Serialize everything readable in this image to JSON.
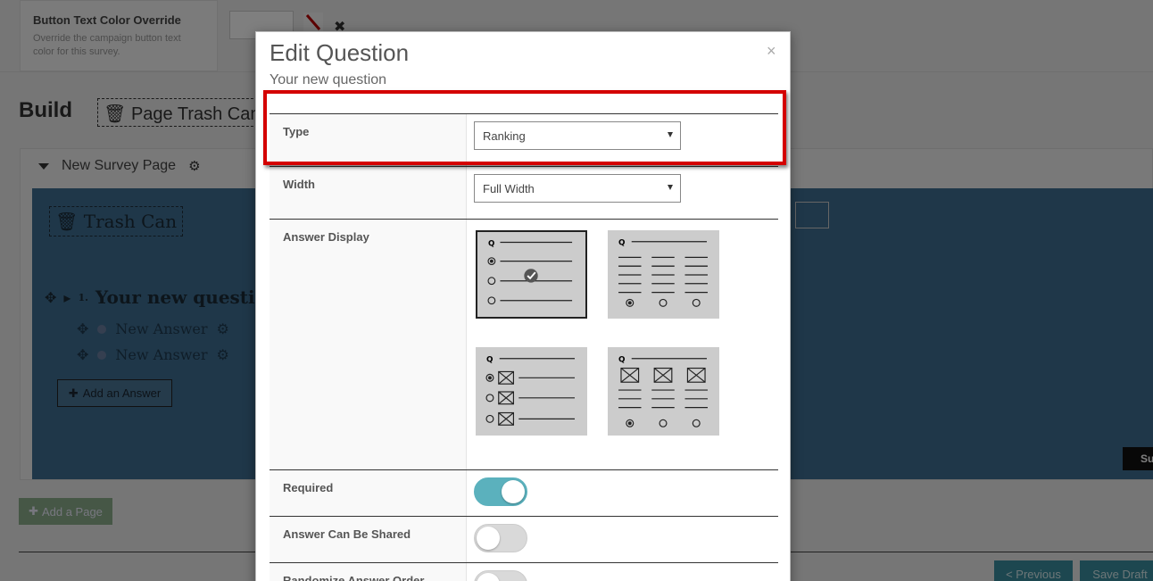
{
  "background": {
    "override": {
      "title": "Button Text Color Override",
      "description": "Override the campaign button text color for this survey."
    },
    "build_title": "Build",
    "page_trash_label": "Page Trash Can",
    "page_name": "New Survey Page",
    "trash_can_label": "Trash Can",
    "question": {
      "number": "1.",
      "text": "Your new question"
    },
    "answers": [
      "New Answer",
      "New Answer"
    ],
    "add_answer_label": "Add an Answer",
    "submit_partial": "Su",
    "add_page_label": "Add a Page",
    "previous_label": "< Previous",
    "save_draft_label": "Save Draft"
  },
  "modal": {
    "title": "Edit Question",
    "subtitle": "Your new question",
    "close_glyph": "×",
    "fields": {
      "type": {
        "label": "Type",
        "value": "Ranking"
      },
      "width": {
        "label": "Width",
        "value": "Full Width"
      },
      "answer_display": {
        "label": "Answer Display"
      },
      "required": {
        "label": "Required",
        "on": true
      },
      "shared": {
        "label": "Answer Can Be Shared",
        "on": false
      },
      "randomize": {
        "label": "Randomize Answer Order",
        "on": false
      }
    }
  },
  "colors": {
    "highlight": "#d40000",
    "toggle_on": "#5bb1bd",
    "toggle_off": "#d9d9d9",
    "page_area": "#3f6f93"
  }
}
